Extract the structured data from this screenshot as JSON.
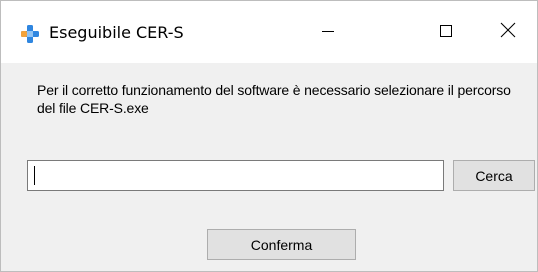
{
  "window": {
    "title": "Eseguibile CER-S",
    "icon": "blue-cross-icon",
    "accent_color": "#3a8ee6"
  },
  "caption_buttons": {
    "minimize_icon": "minimize-icon",
    "maximize_icon": "maximize-icon",
    "close_icon": "close-icon"
  },
  "content": {
    "message": "Per il corretto funzionamento del software è necessario selezionare il percorso del file CER-S.exe",
    "path_input": {
      "value": "",
      "placeholder": ""
    },
    "browse_label": "Cerca",
    "confirm_label": "Conferma"
  }
}
